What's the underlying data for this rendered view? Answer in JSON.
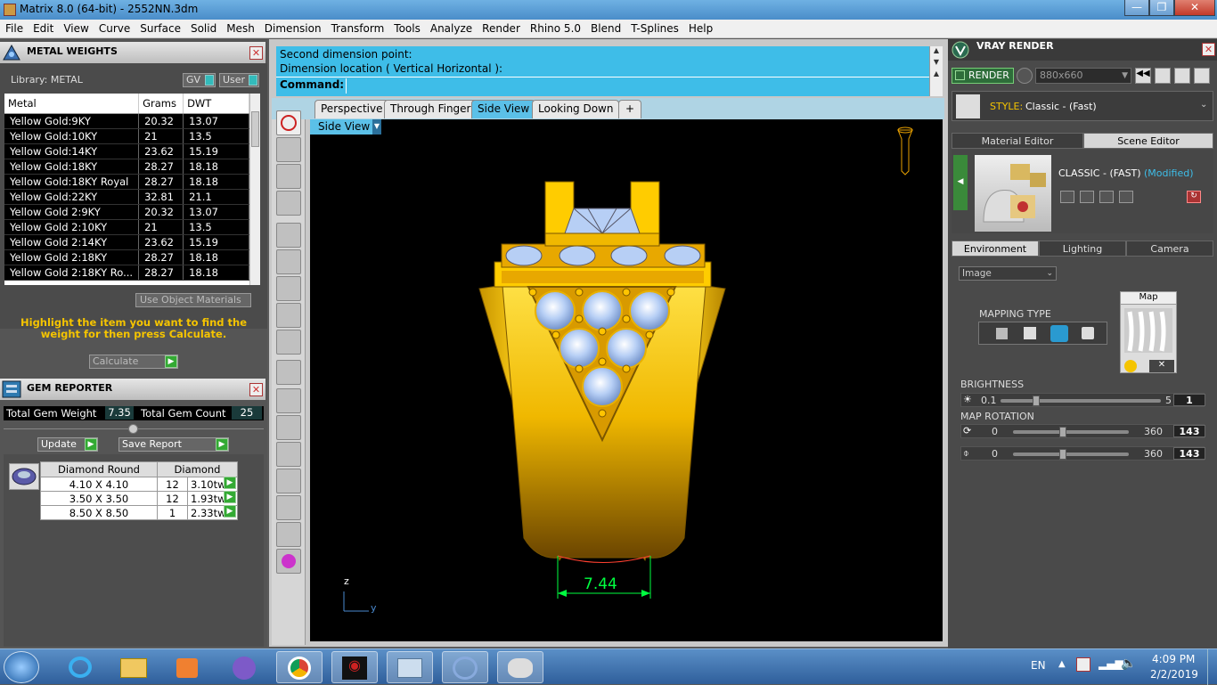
{
  "window": {
    "title": "Matrix 8.0 (64-bit) - 2552NN.3dm",
    "min": "—",
    "max": "❐",
    "close": "✕"
  },
  "menu": [
    "File",
    "Edit",
    "View",
    "Curve",
    "Surface",
    "Solid",
    "Mesh",
    "Dimension",
    "Transform",
    "Tools",
    "Analyze",
    "Render",
    "Rhino 5.0",
    "Blend",
    "T-Splines",
    "Help"
  ],
  "metal_weights": {
    "title": "METAL WEIGHTS",
    "library": "Library: METAL",
    "gv": "GV",
    "user": "User",
    "columns": [
      "Metal",
      "Grams",
      "DWT"
    ],
    "rows": [
      [
        "Yellow Gold:9KY",
        "20.32",
        "13.07"
      ],
      [
        "Yellow Gold:10KY",
        "21",
        "13.5"
      ],
      [
        "Yellow Gold:14KY",
        "23.62",
        "15.19"
      ],
      [
        "Yellow Gold:18KY",
        "28.27",
        "18.18"
      ],
      [
        "Yellow Gold:18KY Royal",
        "28.27",
        "18.18"
      ],
      [
        "Yellow Gold:22KY",
        "32.81",
        "21.1"
      ],
      [
        "Yellow Gold 2:9KY",
        "20.32",
        "13.07"
      ],
      [
        "Yellow Gold 2:10KY",
        "21",
        "13.5"
      ],
      [
        "Yellow Gold 2:14KY",
        "23.62",
        "15.19"
      ],
      [
        "Yellow Gold 2:18KY",
        "28.27",
        "18.18"
      ],
      [
        "Yellow Gold 2:18KY Ro...",
        "28.27",
        "18.18"
      ]
    ],
    "use_object_materials": "Use Object Materials",
    "hint": "Highlight the item you want to find the weight for then press Calculate.",
    "calculate": "Calculate"
  },
  "gem_reporter": {
    "title": "GEM REPORTER",
    "total_weight_label": "Total Gem Weight",
    "total_weight": "7.35",
    "total_count_label": "Total Gem Count",
    "total_count": "25",
    "update": "Update",
    "save_report": "Save Report",
    "columns": [
      "Diamond Round",
      "Diamond"
    ],
    "rows": [
      [
        "4.10 X 4.10",
        "12",
        "3.10tw"
      ],
      [
        "3.50 X 3.50",
        "12",
        "1.93tw"
      ],
      [
        "8.50 X 8.50",
        "1",
        "2.33tw"
      ]
    ]
  },
  "command": {
    "line1": "Second dimension point:",
    "line2": "Dimension location ( Vertical  Horizontal ):",
    "prompt": "Command:"
  },
  "viewport_tabs": [
    "Perspective",
    "Through Finger",
    "Side View",
    "Looking Down"
  ],
  "active_tab": "Side View",
  "viewport": {
    "label": "Side View",
    "dimension": "7.44",
    "axis_z": "z",
    "axis_y": "y"
  },
  "vray": {
    "title": "VRAY RENDER",
    "render": "RENDER",
    "resolution": "880x660",
    "style_label": "STYLE:",
    "style": "Classic - (Fast)",
    "tabs": [
      "Material Editor",
      "Scene Editor"
    ],
    "preset_name": "CLASSIC - (FAST)",
    "preset_mod": "(Modified)",
    "env_tabs": [
      "Environment",
      "Lighting",
      "Camera"
    ],
    "env_type": "Image",
    "mapping_type": "MAPPING TYPE",
    "map_label": "Map",
    "brightness": {
      "label": "BRIGHTNESS",
      "min": "0.1",
      "max": "5",
      "value": "1",
      "level": 0.2
    },
    "map_rotation": {
      "label": "MAP ROTATION",
      "min": "0",
      "max": "360",
      "value1": "143",
      "value2": "143",
      "level": 0.4
    }
  },
  "tray": {
    "lang": "EN",
    "time": "4:09 PM",
    "date": "2/2/2019"
  },
  "colors": {
    "accent": "#3ebde8",
    "gold": "#f5c400",
    "dimension": "#00ff40",
    "taskbar": "#2f5f9b"
  }
}
